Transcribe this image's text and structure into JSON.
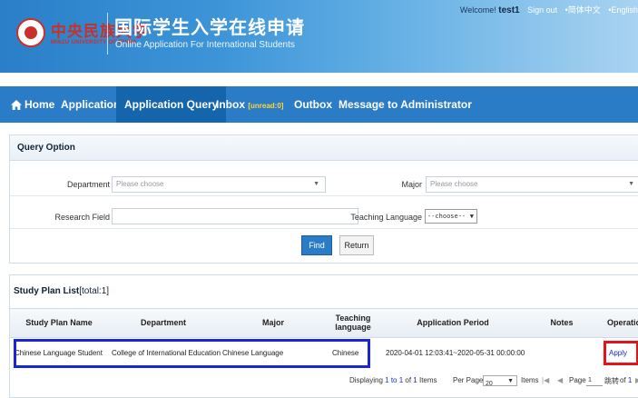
{
  "header": {
    "logo_cn": "中央民族大学",
    "logo_en": "MINZU UNIVERSITY OF CHINA",
    "title_cn": "国际学生入学在线申请",
    "title_en": "Online Application For International Students",
    "welcome": "Welcome!",
    "username": "test1",
    "sign_out": "Sign out",
    "lang_cn": "•简体中文",
    "lang_en": "•English"
  },
  "nav": {
    "home": "Home",
    "application": "Application",
    "application_query": "Application Query",
    "inbox": "Inbox",
    "inbox_unread": "[unread:0]",
    "outbox": "Outbox",
    "message_admin": "Message to Administrator"
  },
  "query": {
    "title": "Query Option",
    "department_label": "Department",
    "department_placeholder": "Please choose",
    "major_label": "Major",
    "major_placeholder": "Please choose",
    "research_label": "Research Field",
    "research_value": "",
    "teaching_label": "Teaching Language",
    "teaching_value": "--choose--",
    "find_label": "Find",
    "return_label": "Return"
  },
  "list": {
    "title": "Study Plan List",
    "total": "[total:1]",
    "headers": {
      "name": "Study Plan Name",
      "department": "Department",
      "major": "Major",
      "teaching": "Teaching language",
      "period": "Application Period",
      "notes": "Notes",
      "operation": "Operation"
    },
    "rows": [
      {
        "name": "Chinese Language Student",
        "department": "College of International Education",
        "major": "Chinese Language",
        "teaching": "Chinese",
        "period": "2020-04-01 12:03:41~2020-05-31 00:00:00",
        "notes": "",
        "operation": "Apply"
      }
    ],
    "pager": {
      "displaying": "Displaying",
      "range": "1 to 1",
      "of_word": "of",
      "total": "1",
      "items_word": "Items",
      "per_page": "Per Page",
      "per_page_value": "20",
      "items_label": "Items",
      "page_label": "Page",
      "page_value": "1",
      "jump": "跳转",
      "of_pages_word": "of",
      "pages": "1"
    }
  },
  "colors": {
    "nav_bg": "#2b7cc6",
    "nav_active": "#1565ad",
    "highlight_blue": "#1a25d6",
    "highlight_red": "#e2141c"
  }
}
